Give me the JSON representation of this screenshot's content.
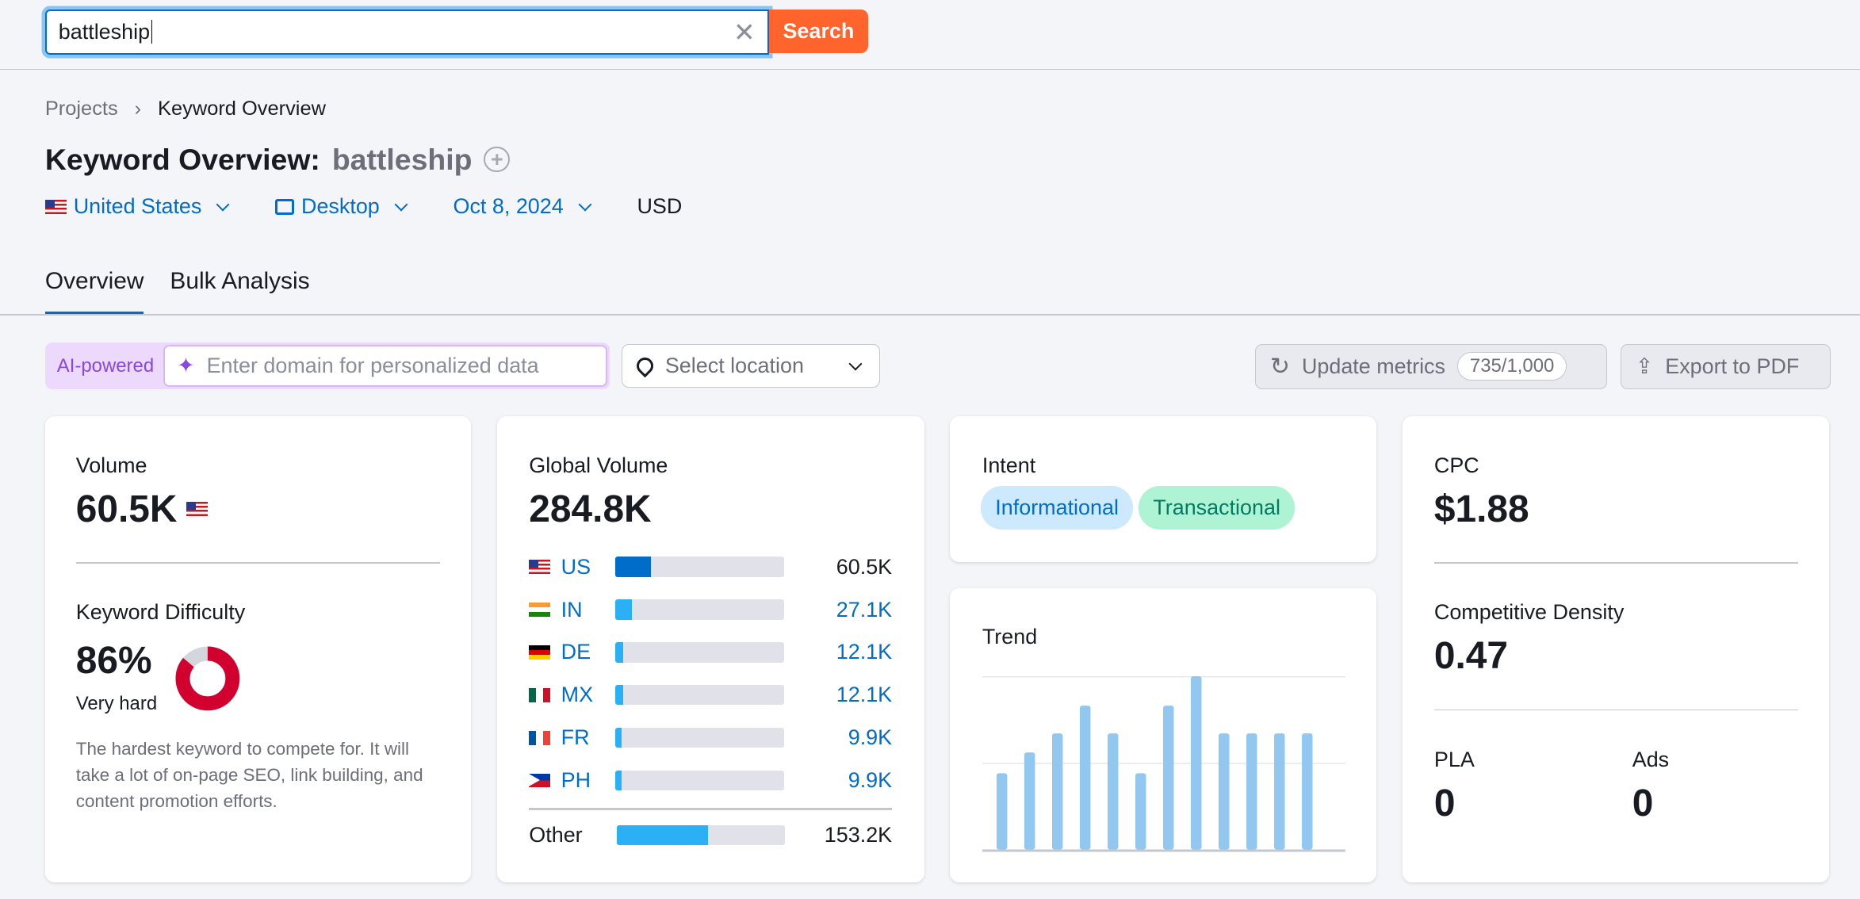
{
  "search": {
    "value": "battleship",
    "clear_icon": "close-icon",
    "button": "Search"
  },
  "breadcrumb": {
    "parent": "Projects",
    "current": "Keyword Overview"
  },
  "title": {
    "label": "Keyword Overview:",
    "keyword": "battleship"
  },
  "filters": {
    "country": "United States",
    "device": "Desktop",
    "date": "Oct 8, 2024",
    "currency": "USD"
  },
  "tabs": [
    {
      "label": "Overview",
      "active": true
    },
    {
      "label": "Bulk Analysis",
      "active": false
    }
  ],
  "toolbar": {
    "ai_label": "AI-powered",
    "domain_placeholder": "Enter domain for personalized data",
    "location_placeholder": "Select location",
    "update_label": "Update metrics",
    "update_count": "735/1,000",
    "export_label": "Export to PDF"
  },
  "volume": {
    "label": "Volume",
    "value": "60.5K",
    "kd_label": "Keyword Difficulty",
    "kd_value": "86%",
    "kd_percent": 86,
    "kd_text": "Very hard",
    "kd_desc": "The hardest keyword to compete for. It will take a lot of on-page SEO, link building, and content promotion efforts.",
    "kd_color": "#d1002f"
  },
  "global": {
    "label": "Global Volume",
    "value": "284.8K",
    "rows": [
      {
        "flag": "us",
        "code": "US",
        "value": "60.5K",
        "share": 0.21
      },
      {
        "flag": "in",
        "code": "IN",
        "value": "27.1K",
        "share": 0.095
      },
      {
        "flag": "de",
        "code": "DE",
        "value": "12.1K",
        "share": 0.043
      },
      {
        "flag": "mx",
        "code": "MX",
        "value": "12.1K",
        "share": 0.043
      },
      {
        "flag": "fr",
        "code": "FR",
        "value": "9.9K",
        "share": 0.035
      },
      {
        "flag": "ph",
        "code": "PH",
        "value": "9.9K",
        "share": 0.035
      }
    ],
    "other": {
      "label": "Other",
      "value": "153.2K",
      "share": 0.54
    }
  },
  "intent": {
    "label": "Intent",
    "tags": [
      "Informational",
      "Transactional"
    ]
  },
  "trend": {
    "label": "Trend",
    "values": [
      0.44,
      0.56,
      0.67,
      0.83,
      0.67,
      0.44,
      0.83,
      1.0,
      0.67,
      0.67,
      0.67,
      0.67
    ],
    "color": "#92c7ef"
  },
  "cpc": {
    "label": "CPC",
    "value": "$1.88",
    "cd_label": "Competitive Density",
    "cd_value": "0.47",
    "pla_label": "PLA",
    "pla_value": "0",
    "ads_label": "Ads",
    "ads_value": "0"
  }
}
